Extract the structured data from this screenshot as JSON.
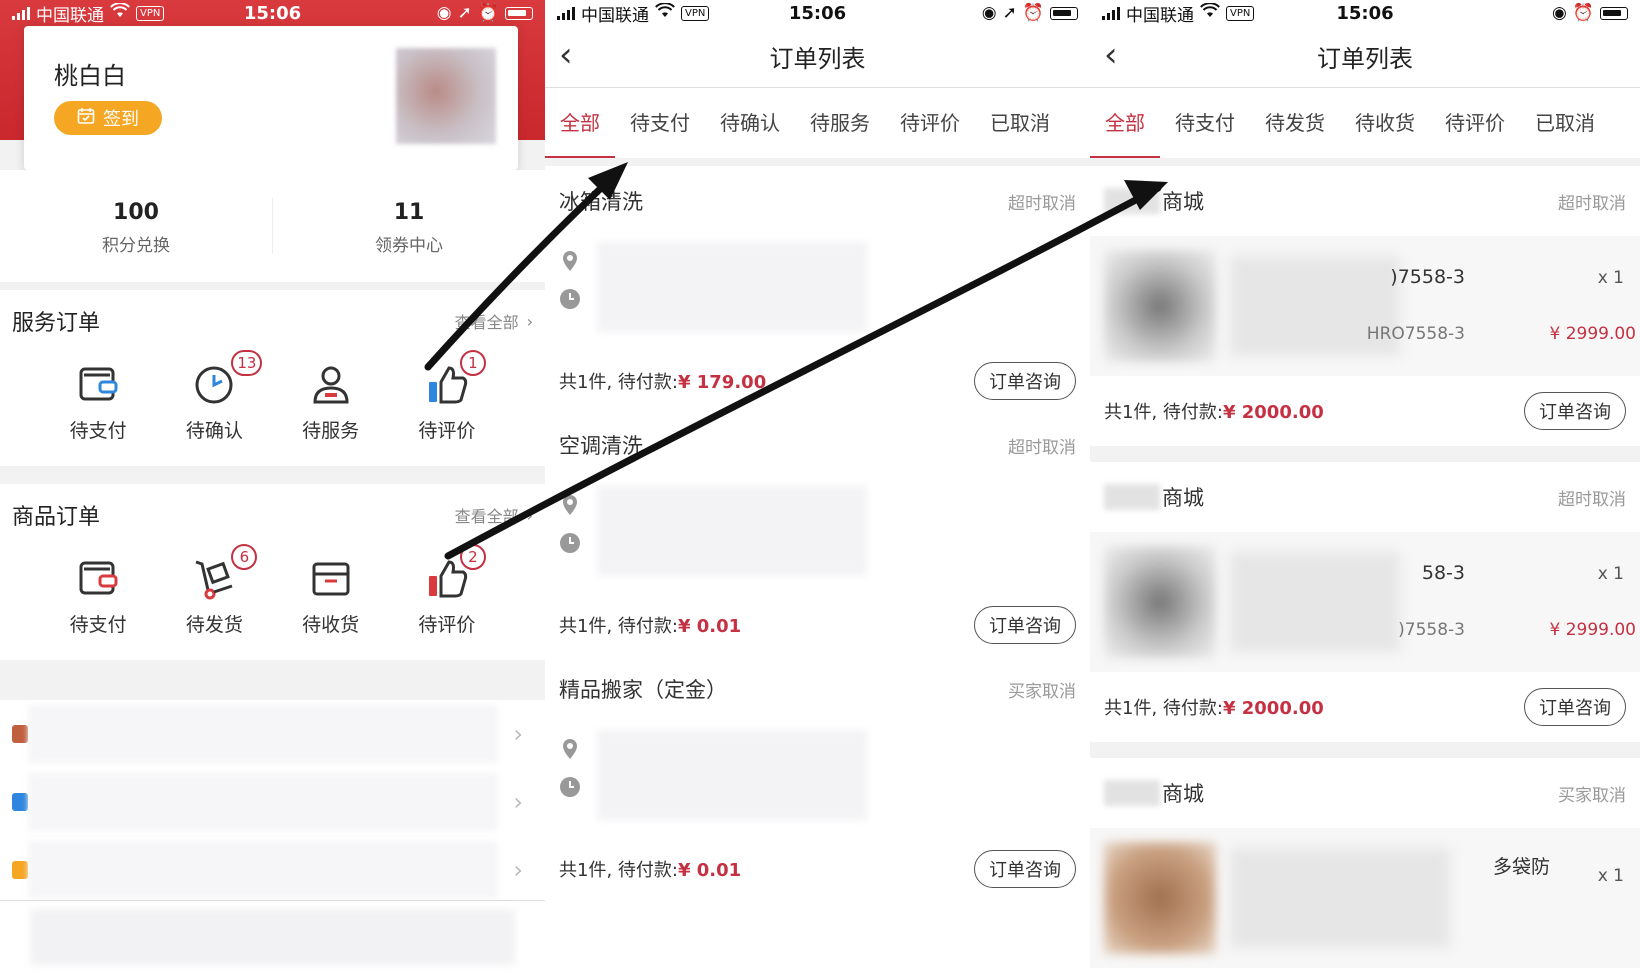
{
  "status_bar": {
    "carrier": "中国联通",
    "vpn": "VPN",
    "time": "15:06"
  },
  "profile_screen": {
    "username": "桃白白",
    "signin_label": "签到",
    "stats": [
      {
        "value": "100",
        "label": "积分兑换"
      },
      {
        "value": "11",
        "label": "领券中心"
      }
    ],
    "service_orders": {
      "title": "服务订单",
      "more": "查看全部",
      "items": [
        {
          "label": "待支付",
          "icon": "wallet-icon",
          "badge": ""
        },
        {
          "label": "待确认",
          "icon": "clock-icon",
          "badge": "13"
        },
        {
          "label": "待服务",
          "icon": "person-icon",
          "badge": ""
        },
        {
          "label": "待评价",
          "icon": "thumbs-up-icon",
          "badge": "1"
        }
      ]
    },
    "goods_orders": {
      "title": "商品订单",
      "more": "查看全部",
      "items": [
        {
          "label": "待支付",
          "icon": "wallet-icon",
          "badge": ""
        },
        {
          "label": "待发货",
          "icon": "cart-icon",
          "badge": "6"
        },
        {
          "label": "待收货",
          "icon": "box-icon",
          "badge": ""
        },
        {
          "label": "待评价",
          "icon": "thumbs-up-icon",
          "badge": "2"
        }
      ]
    }
  },
  "service_order_list": {
    "title": "订单列表",
    "tabs": [
      "全部",
      "待支付",
      "待确认",
      "待服务",
      "待评价",
      "已取消"
    ],
    "active_tab": "全部",
    "orders": [
      {
        "name": "冰箱清洗",
        "status": "超时取消",
        "total_label": "共1件, 待付款:",
        "amount": "¥ 179.00",
        "button": "订单咨询"
      },
      {
        "name": "空调清洗",
        "status": "超时取消",
        "total_label": "共1件, 待付款:",
        "amount": "¥ 0.01",
        "button": "订单咨询"
      },
      {
        "name": "精品搬家（定金）",
        "status": "买家取消",
        "total_label": "共1件, 待付款:",
        "amount": "¥ 0.01",
        "button": "订单咨询"
      }
    ]
  },
  "goods_order_list": {
    "title": "订单列表",
    "tabs": [
      "全部",
      "待支付",
      "待发货",
      "待收货",
      "待评价",
      "已取消"
    ],
    "active_tab": "全部",
    "orders": [
      {
        "shop": "商城",
        "status": "超时取消",
        "product_title": ")7558-3",
        "product_code": "HRO7558-3",
        "qty": "x 1",
        "price": "¥ 2999.00",
        "total_label": "共1件, 待付款:",
        "amount": "¥ 2000.00",
        "button": "订单咨询"
      },
      {
        "shop": "商城",
        "status": "超时取消",
        "product_title": "58-3",
        "product_code": ")7558-3",
        "qty": "x 1",
        "price": "¥ 2999.00",
        "total_label": "共1件, 待付款:",
        "amount": "¥ 2000.00",
        "button": "订单咨询"
      },
      {
        "shop": "商城",
        "status": "买家取消",
        "product_title": "多袋防",
        "product_code": "",
        "qty": "x 1",
        "price": "",
        "total_label": "",
        "amount": "",
        "button": ""
      }
    ]
  },
  "colors": {
    "brand_red": "#c43142",
    "header_red": "#d83a3e",
    "signin_orange": "#f5a623"
  }
}
